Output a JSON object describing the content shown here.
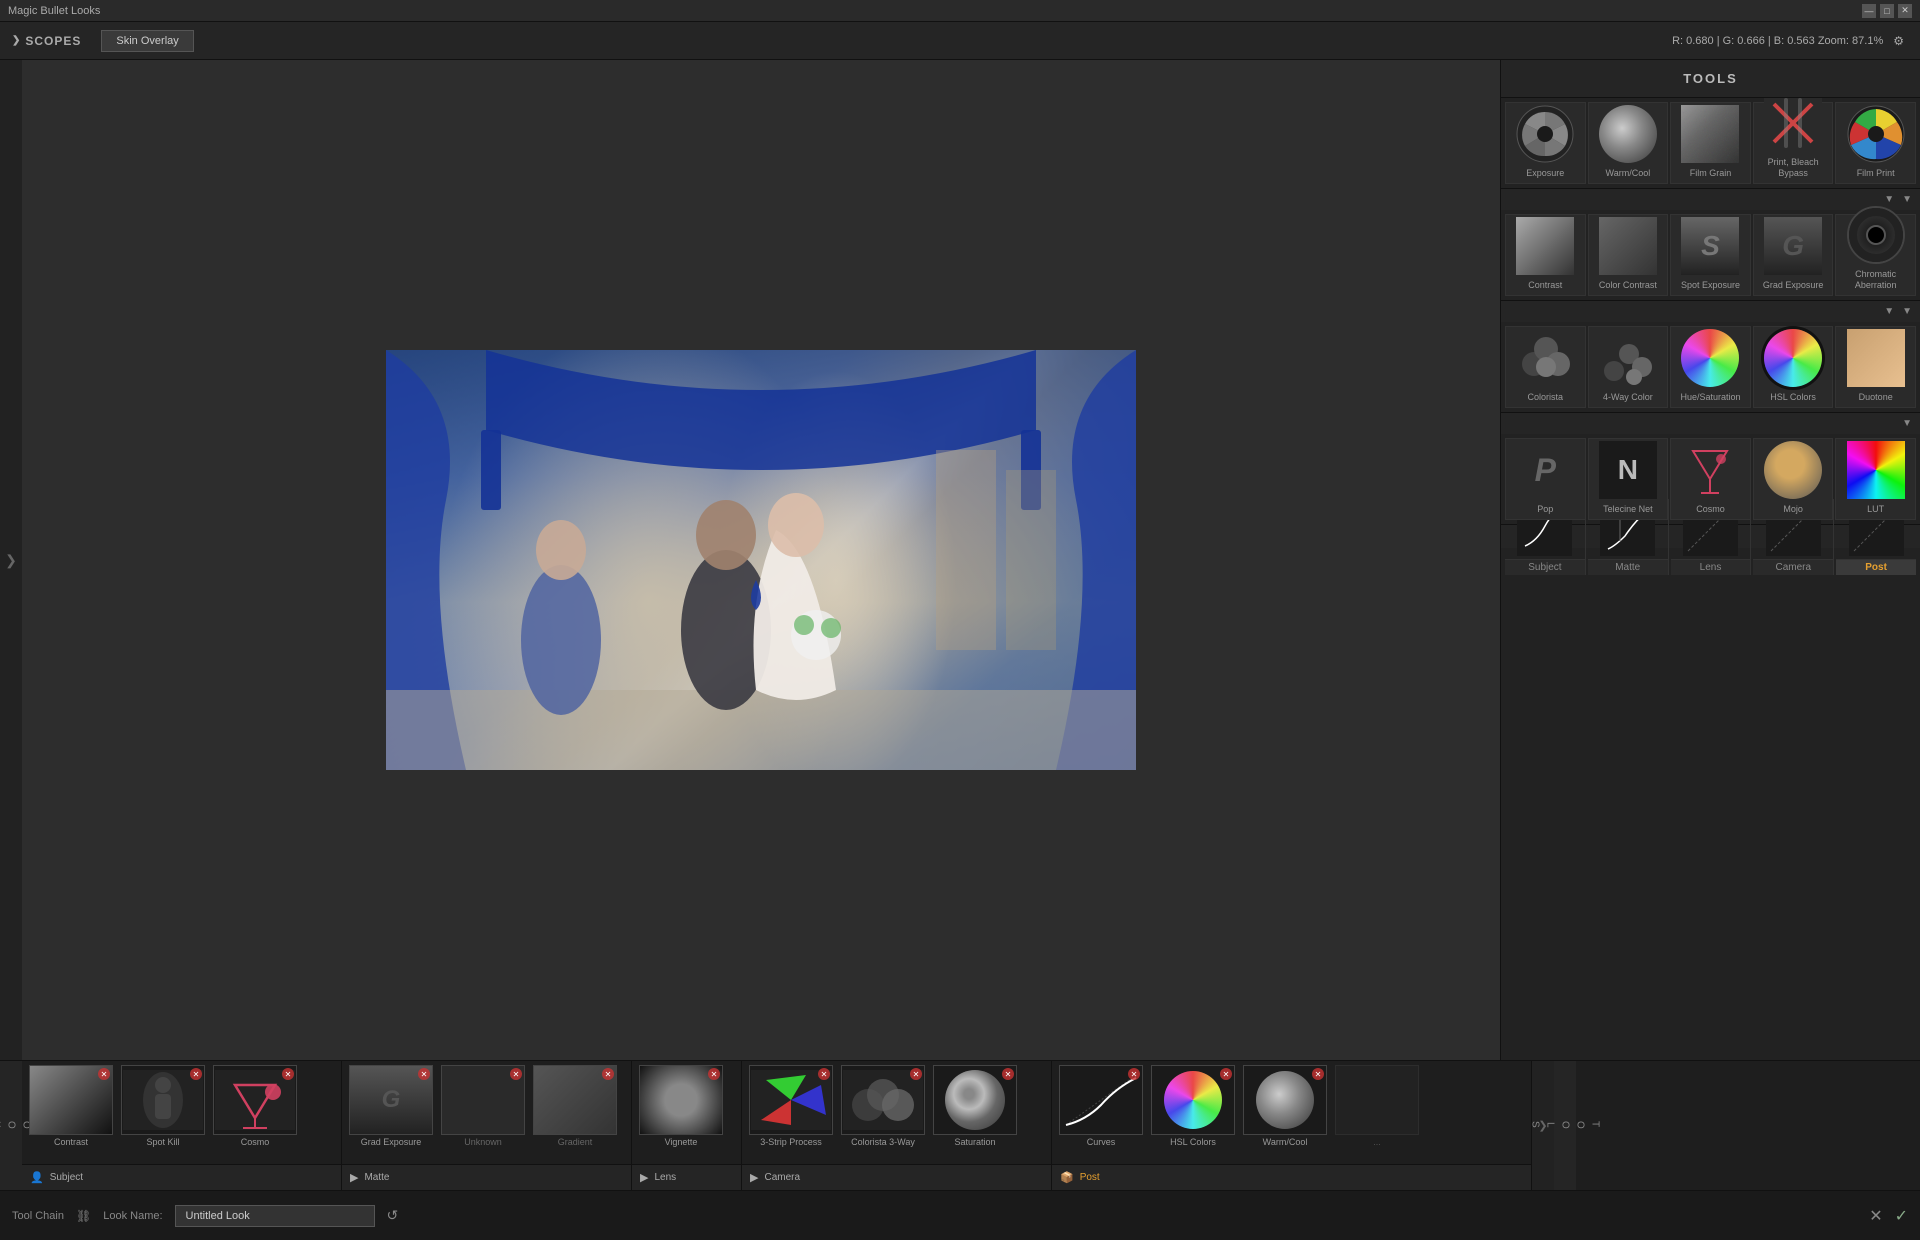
{
  "titlebar": {
    "title": "Magic Bullet Looks",
    "min_btn": "—",
    "max_btn": "□",
    "close_btn": "✕"
  },
  "topbar": {
    "scopes_label": "SCOPES",
    "skin_overlay_label": "Skin Overlay",
    "color_info": "R: 0.680 | G: 0.666 | B: 0.563    Zoom: 87.1%",
    "settings_icon": "⚙"
  },
  "tools": {
    "header": "TOOLS",
    "row1": [
      {
        "id": "exposure",
        "label": "Exposure",
        "type": "aperture"
      },
      {
        "id": "warmcool",
        "label": "Warm/Cool",
        "type": "warmcool"
      },
      {
        "id": "filmgrain",
        "label": "Film Grain",
        "type": "filmgrain"
      },
      {
        "id": "printbleachbypass",
        "label": "Print, Bleach Bypass",
        "type": "crossx"
      },
      {
        "id": "filmprint",
        "label": "Film Print",
        "type": "filmprint"
      }
    ],
    "row2": [
      {
        "id": "contrast",
        "label": "Contrast",
        "type": "contrast"
      },
      {
        "id": "colorcontrast",
        "label": "Color Contrast",
        "type": "colorcontrast"
      },
      {
        "id": "spotexposure",
        "label": "Spot Exposure",
        "type": "spotexposure"
      },
      {
        "id": "gradexposure",
        "label": "Grad Exposure",
        "type": "gradexposure"
      },
      {
        "id": "chromatic",
        "label": "Chromatic Aberration",
        "type": "chromatic"
      }
    ],
    "row3": [
      {
        "id": "colorista",
        "label": "Colorista",
        "type": "colorista"
      },
      {
        "id": "4waycolor",
        "label": "4-Way Color",
        "type": "4waycolor"
      },
      {
        "id": "huesat",
        "label": "Hue/Saturation",
        "type": "huesat"
      },
      {
        "id": "hslcolors",
        "label": "HSL Colors",
        "type": "hslcolors"
      },
      {
        "id": "duotone",
        "label": "Duotone",
        "type": "duotone"
      }
    ],
    "row4": [
      {
        "id": "pop",
        "label": "Pop",
        "type": "pop"
      },
      {
        "id": "telecinenet",
        "label": "Telecine Net",
        "type": "telecinenet"
      },
      {
        "id": "cosmo",
        "label": "Cosmo",
        "type": "cosmo"
      },
      {
        "id": "mojo",
        "label": "Mojo",
        "type": "mojo"
      },
      {
        "id": "lut",
        "label": "LUT",
        "type": "lut"
      }
    ],
    "section_tabs": [
      {
        "id": "subject",
        "label": "Subject",
        "active": false
      },
      {
        "id": "matte",
        "label": "Matte",
        "active": false
      },
      {
        "id": "lens",
        "label": "Lens",
        "active": false
      },
      {
        "id": "camera",
        "label": "Camera",
        "active": false
      },
      {
        "id": "post",
        "label": "Post",
        "active": true
      }
    ]
  },
  "looks_strip": {
    "looks_label": "L\nO\nO\nK\nS",
    "tools_label": "T\nO\nO\nL\nS",
    "sections": [
      {
        "id": "subject",
        "label": "Subject",
        "icon": "👤",
        "items": [
          {
            "id": "contrast-look",
            "label": "Contrast",
            "type": "contrast"
          },
          {
            "id": "spot-look",
            "label": "Spot Kill",
            "type": "spot"
          },
          {
            "id": "cosmo-look",
            "label": "Cosmo",
            "type": "cosmo"
          }
        ]
      },
      {
        "id": "matte",
        "label": "Matte",
        "icon": "▶",
        "items": [
          {
            "id": "grad-exposure-look",
            "label": "Grad Exposure",
            "type": "gradexposure"
          },
          {
            "id": "unknown-look",
            "label": "Unknown",
            "type": "unknown"
          },
          {
            "id": "gradient-look",
            "label": "Gradient",
            "type": "gradient"
          }
        ]
      },
      {
        "id": "lens",
        "label": "Lens",
        "icon": "▶",
        "items": [
          {
            "id": "vignette-look",
            "label": "Vignette",
            "type": "vignette"
          }
        ]
      },
      {
        "id": "camera",
        "label": "Camera",
        "icon": "▶",
        "items": [
          {
            "id": "3strip-look",
            "label": "3-Strip Process",
            "type": "3strip"
          },
          {
            "id": "colorista3-look",
            "label": "Colorista 3-Way",
            "type": "colorista3"
          },
          {
            "id": "saturation-look",
            "label": "Saturation",
            "type": "saturation"
          }
        ]
      },
      {
        "id": "post",
        "label": "Post",
        "icon": "📦",
        "items": [
          {
            "id": "curves-look",
            "label": "Curves",
            "type": "curves"
          },
          {
            "id": "hslcolors-look",
            "label": "HSL Colors",
            "type": "hslcolors"
          },
          {
            "id": "warmcool-look",
            "label": "Warm/Cool",
            "type": "warmcool"
          },
          {
            "id": "unknown2-look",
            "label": "...",
            "type": "unknown2"
          }
        ]
      }
    ]
  },
  "bottom_toolbar": {
    "tool_chain_label": "Tool Chain",
    "look_name_label": "Look Name:",
    "look_name_value": "Untitled Look",
    "look_name_placeholder": "Untitled Look",
    "reset_icon": "↺",
    "cancel_icon": "✕",
    "confirm_icon": "✓"
  },
  "left_nav": {
    "arrow": "❯"
  },
  "right_nav": {
    "arrow": "❯"
  }
}
